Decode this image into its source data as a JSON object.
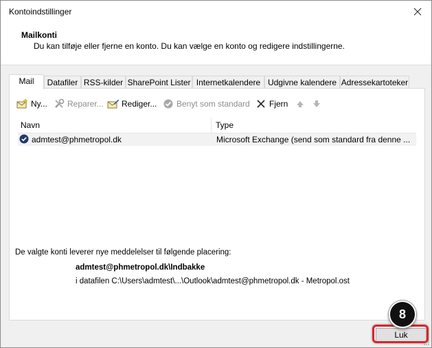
{
  "window": {
    "title": "Kontoindstillinger",
    "close_symbol": "✕"
  },
  "header": {
    "title": "Mailkonti",
    "description": "Du kan tilføje eller fjerne en konto. Du kan vælge en konto og redigere indstillingerne."
  },
  "tabs": [
    {
      "label": "Mail",
      "active": true
    },
    {
      "label": "Datafiler"
    },
    {
      "label": "RSS-kilder"
    },
    {
      "label": "SharePoint Lister"
    },
    {
      "label": "Internetkalendere"
    },
    {
      "label": "Udgivne kalendere"
    },
    {
      "label": "Adressekartoteker"
    }
  ],
  "toolbar": {
    "new_label": "Ny...",
    "repair_label": "Reparer...",
    "edit_label": "Rediger...",
    "set_default_label": "Benyt som standard",
    "remove_label": "Fjern",
    "icons": {
      "new": "new-account-icon",
      "repair": "repair-icon",
      "edit": "edit-icon",
      "set_default": "check-circle-icon",
      "remove": "x-icon",
      "up": "arrow-up-icon",
      "down": "arrow-down-icon"
    }
  },
  "accounts_list": {
    "columns": [
      "Navn",
      "Type"
    ],
    "rows": [
      {
        "name": "admtest@phmetropol.dk",
        "type": "Microsoft Exchange (send som standard fra denne ..."
      }
    ]
  },
  "delivery": {
    "text": "De valgte konti leverer nye meddelelser til følgende placering:",
    "folder": "admtest@phmetropol.dk\\Indbakke",
    "path": "i datafilen C:\\Users\\admtest\\...\\Outlook\\admtest@phmetropol.dk - Metropol.ost"
  },
  "footer": {
    "close_label": "Luk"
  },
  "annotation": {
    "step_number": "8"
  },
  "colors": {
    "highlight": "#d9252a",
    "badge": "#111111"
  }
}
